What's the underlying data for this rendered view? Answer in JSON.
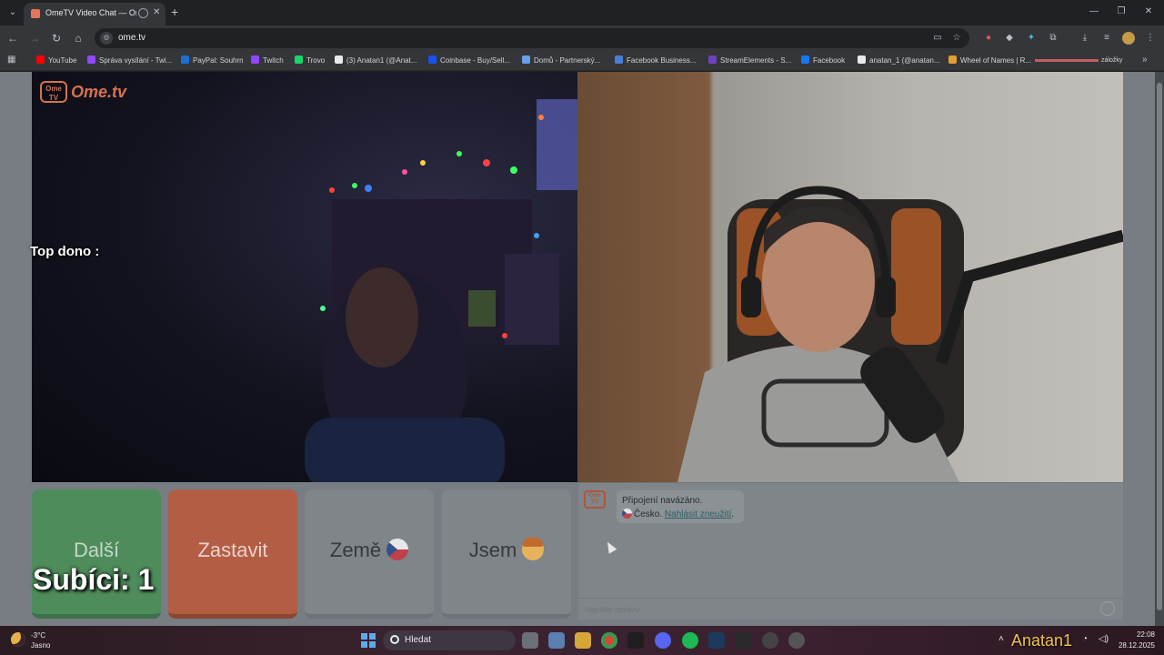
{
  "browser": {
    "tab_title": "OmeTV Video Chat — Ome",
    "url": "ome.tv"
  },
  "bookmarks": [
    {
      "label": "YouTube",
      "color": "#ff0000"
    },
    {
      "label": "Správa vysílání - Twi...",
      "color": "#9146ff"
    },
    {
      "label": "PayPal: Souhrn",
      "color": "#1d6fd1"
    },
    {
      "label": "Twitch",
      "color": "#9146ff"
    },
    {
      "label": "Trovo",
      "color": "#19d66b"
    },
    {
      "label": "(3) Anatan1 (@Anat...",
      "color": "#e8eaed"
    },
    {
      "label": "Coinbase - Buy/Sell...",
      "color": "#1652f0"
    },
    {
      "label": "Domů - Partnerský...",
      "color": "#6aa0e8"
    },
    {
      "label": "Facebook Business...",
      "color": "#4a7ed6"
    },
    {
      "label": "StreamElements - S...",
      "color": "#6f42c1"
    },
    {
      "label": "Facebook",
      "color": "#1877f2"
    },
    {
      "label": "anatan_1 (@anatan...",
      "color": "#e8eaed"
    },
    {
      "label": "Wheel of Names | R...",
      "color": "#e0a030"
    }
  ],
  "bookmarks_other": "záložky",
  "page": {
    "logo_box": "Ome TV",
    "logo_text": "Ome.tv",
    "overlay_top_dono": "Top dono :",
    "overlay_subs": "Subíci: 1",
    "buttons": {
      "next": "Další",
      "stop": "Zastavit",
      "country": "Země",
      "gender": "Jsem"
    },
    "chat": {
      "logo": "Ome TV",
      "connected": "Připojení navázáno.",
      "country": "Česko.",
      "report": "Nahlásit zneužití",
      "input_placeholder": "Napište zprávu"
    }
  },
  "taskbar": {
    "weather_temp": "-3°C",
    "weather_desc": "Jasno",
    "search_label": "Hledat",
    "time": "22:08",
    "date": "28.12.2025",
    "watermark": "Anatan1"
  }
}
